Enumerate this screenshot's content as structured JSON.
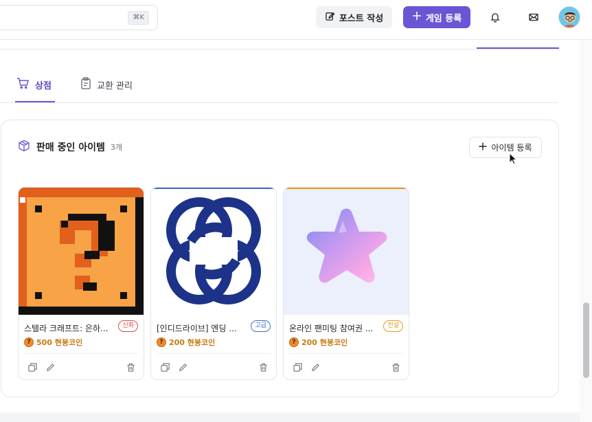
{
  "header": {
    "search_shortcut": "⌘K",
    "post_button": "포스트 작성",
    "game_button": "게임 등록"
  },
  "tabs": [
    {
      "label": "상점",
      "active": true
    },
    {
      "label": "교환 관리",
      "active": false
    }
  ],
  "panel": {
    "title": "판매 중인 아이템",
    "count": "3개",
    "add_button": "아이템 등록"
  },
  "items": [
    {
      "name": "스텔라 크래프트: 은하...",
      "grade": "신화",
      "grade_color": "#d94a4a",
      "price": "500 현붕코인",
      "accent": "#e05a1e"
    },
    {
      "name": "[인디드라이브] 엔딩 ...",
      "grade": "고급",
      "grade_color": "#3d6cc4",
      "price": "200 현붕코인",
      "accent": "#3d6cc4"
    },
    {
      "name": "온라인 팬미팅 참여권 ...",
      "grade": "전설",
      "grade_color": "#e39a1b",
      "price": "200 현붕코인",
      "accent": "#e39a1b"
    }
  ],
  "colors": {
    "primary": "#6a55d5",
    "coin": "#f08b2d"
  }
}
